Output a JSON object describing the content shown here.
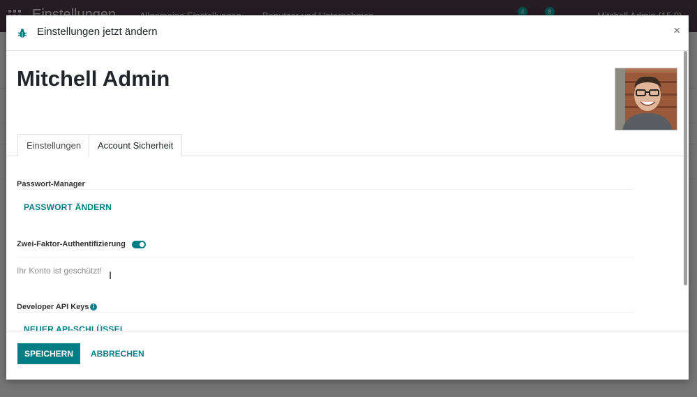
{
  "background_app": {
    "app_title": "Einstellungen",
    "menu": [
      "Allgemeine Einstellungen",
      "Benutzer und Unternehmen"
    ],
    "badges": [
      "4",
      "8"
    ],
    "user_label": "Mitchell Admin (15.0)"
  },
  "dialog": {
    "title": "Einstellungen jetzt ändern",
    "close_label": "×",
    "user_name": "Mitchell Admin",
    "tabs": [
      {
        "label": "Einstellungen",
        "active": false
      },
      {
        "label": "Account Sicherheit",
        "active": true
      }
    ],
    "password_section": {
      "label": "Passwort-Manager",
      "action": "PASSWORT ÄNDERN"
    },
    "two_factor_section": {
      "label": "Zwei-Faktor-Authentifizierung",
      "enabled": true,
      "status_text": "Ihr Konto ist geschützt!"
    },
    "api_keys_section": {
      "label": "Developer API Keys",
      "info_icon": "i",
      "action": "NEUER API-SCHLÜSSEL"
    },
    "footer": {
      "save": "SPEICHERN",
      "cancel": "ABBRECHEN"
    }
  },
  "colors": {
    "accent": "#017e84",
    "topbar": "#4a3a47",
    "badge": "#00a09d"
  }
}
